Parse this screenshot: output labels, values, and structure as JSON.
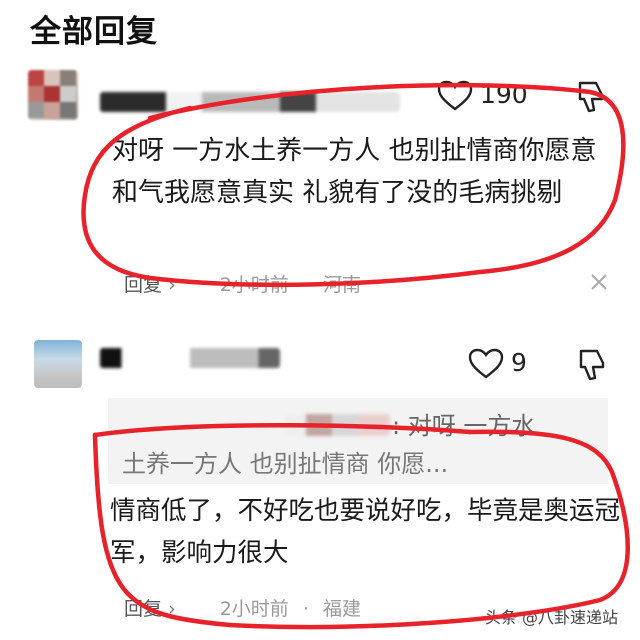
{
  "header": {
    "title": "全部回复"
  },
  "comment1": {
    "likes": "190",
    "text": "对呀 一方水土养一方人 也别扯情商你愿意和气我愿意真实 礼貌有了没的毛病挑剔",
    "reply_label": "回复",
    "time": "2小时前",
    "location": "河南"
  },
  "comment2": {
    "likes": "9",
    "quote_line1": ": 对呀 一方水",
    "quote_line2": "土养一方人 也别扯情商 你愿...",
    "text": "情商低了，不好吃也要说好吃，毕竟是奥运冠军，影响力很大",
    "reply_label": "回复",
    "time": "2小时前",
    "location": "福建"
  },
  "watermark": "头条 @八卦速递站",
  "colors": {
    "annotation": "#e8222b",
    "meta": "#9a9a9a"
  },
  "icons": [
    "heart-icon",
    "dislike-icon",
    "chevron-right-icon",
    "close-icon"
  ]
}
